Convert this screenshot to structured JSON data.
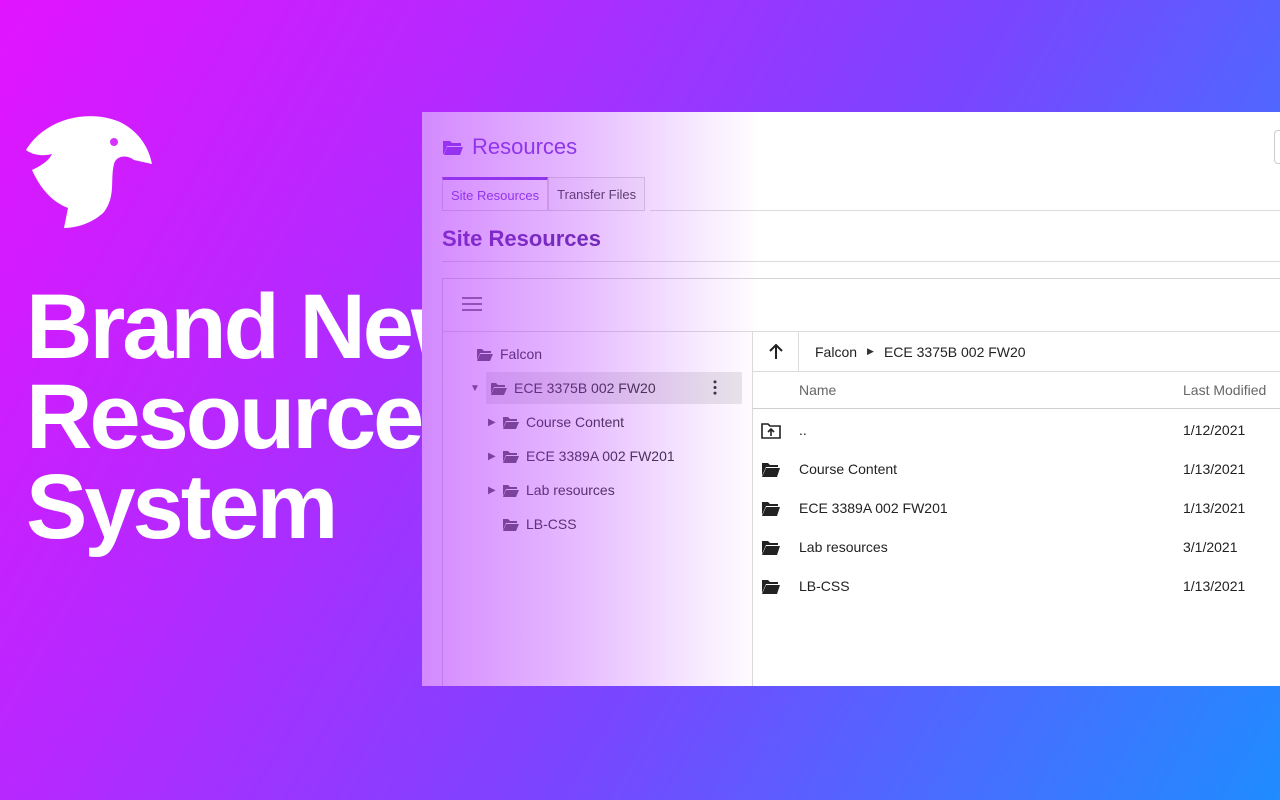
{
  "headline": {
    "line1": "Brand New",
    "line2": "Resources",
    "line3": "System"
  },
  "app": {
    "title": "Resources",
    "tabs": [
      {
        "label": "Site Resources",
        "active": true
      },
      {
        "label": "Transfer Files",
        "active": false
      }
    ],
    "section_title": "Site Resources"
  },
  "tree": {
    "root": "Falcon",
    "selected": "ECE 3375B 002 FW20",
    "children": [
      "Course Content",
      "ECE 3389A 002 FW201",
      "Lab resources",
      "LB-CSS"
    ]
  },
  "breadcrumb": [
    "Falcon",
    "ECE 3375B 002 FW20"
  ],
  "columns": {
    "name": "Name",
    "modified": "Last Modified"
  },
  "rows": [
    {
      "name": "..",
      "modified": "1/12/2021",
      "icon": "folder-up-icon"
    },
    {
      "name": "Course Content",
      "modified": "1/13/2021",
      "icon": "folder-icon"
    },
    {
      "name": "ECE 3389A 002 FW201",
      "modified": "1/13/2021",
      "icon": "folder-icon"
    },
    {
      "name": "Lab resources",
      "modified": "3/1/2021",
      "icon": "folder-icon"
    },
    {
      "name": "LB-CSS",
      "modified": "1/13/2021",
      "icon": "folder-icon"
    }
  ],
  "colors": {
    "accent": "#7a3ce0",
    "gradient_start": "#e214ff",
    "gradient_end": "#1f8cff"
  }
}
